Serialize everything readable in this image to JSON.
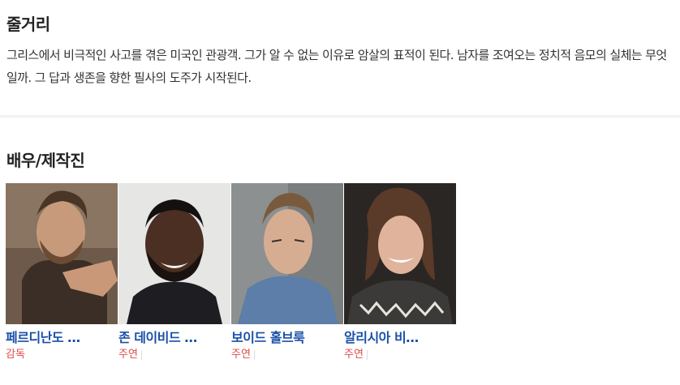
{
  "synopsis": {
    "title": "줄거리",
    "text": "그리스에서 비극적인 사고를 겪은 미국인 관광객. 그가 알 수 없는 이유로 암살의 표적이 된다. 남자를 조여오는 정치적 음모의 실체는 무엇일까. 그 답과 생존을 향한 필사의 도주가 시작된다."
  },
  "cast": {
    "title": "배우/제작진",
    "members": [
      {
        "name": "페르디난도 …",
        "role": "감독",
        "photo": "person-photo"
      },
      {
        "name": "존 데이비드 …",
        "role": "주연",
        "photo": "person-photo"
      },
      {
        "name": "보이드 홀브룩",
        "role": "주연",
        "photo": "person-photo"
      },
      {
        "name": "알리시아 비…",
        "role": "주연",
        "photo": "person-photo"
      }
    ]
  },
  "colors": {
    "name_link": "#1a4fa8",
    "role": "#e04b4b"
  }
}
